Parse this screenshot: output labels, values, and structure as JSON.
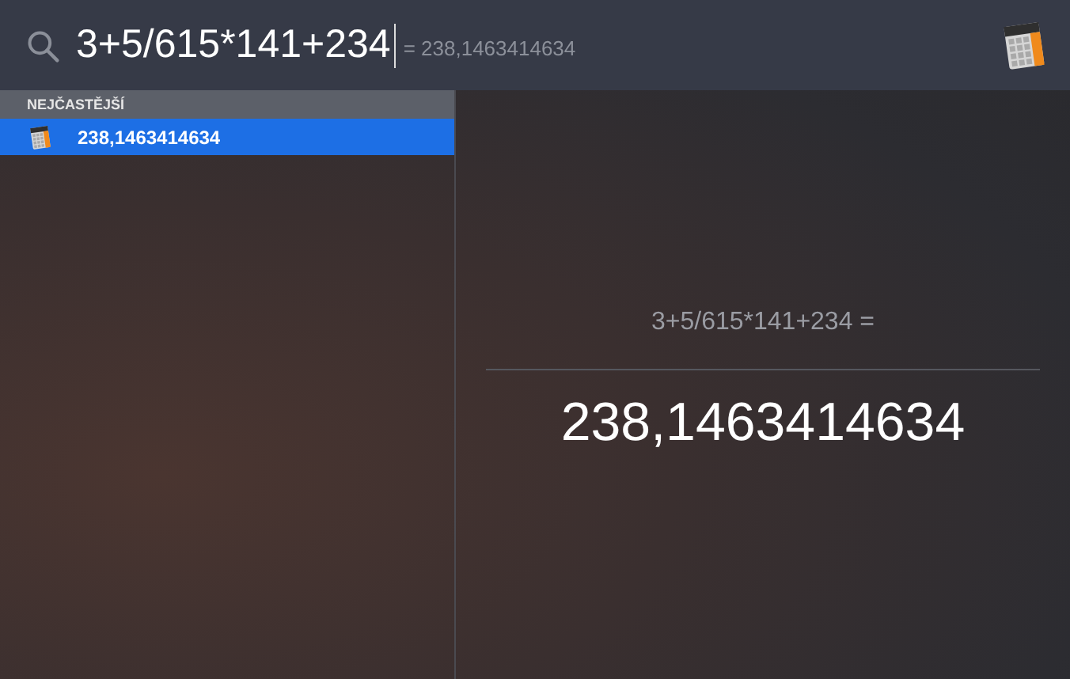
{
  "search": {
    "value": "3+5/615*141+234",
    "completion": "= 238,1463414634"
  },
  "results": {
    "section": "NEJČASTĚJŠÍ",
    "items": [
      {
        "label": "238,1463414634",
        "selected": true
      }
    ]
  },
  "preview": {
    "expression": "3+5/615*141+234 =",
    "result": "238,1463414634"
  }
}
